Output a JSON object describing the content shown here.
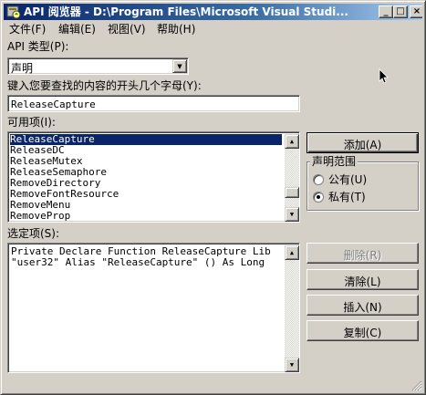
{
  "window": {
    "title": "API 阅览器 - D:\\Program Files\\Microsoft Visual Studi...",
    "minimize": "_",
    "maximize": "□",
    "close": "×"
  },
  "menu": {
    "file": "文件(F)",
    "edit": "编辑(E)",
    "view": "视图(V)",
    "help": "帮助(H)"
  },
  "api_type": {
    "label": "API 类型(P):",
    "value": "声明"
  },
  "search": {
    "label": "键入您要查找的内容的开头几个字母(Y):",
    "value": "ReleaseCapture"
  },
  "available": {
    "label": "可用项(I):",
    "items": [
      "ReleaseCapture",
      "ReleaseDC",
      "ReleaseMutex",
      "ReleaseSemaphore",
      "RemoveDirectory",
      "RemoveFontResource",
      "RemoveMenu",
      "RemoveProp"
    ],
    "selected_index": 0
  },
  "buttons": {
    "add": "添加(A)",
    "delete": "删除(R)",
    "clear": "清除(L)",
    "insert": "插入(N)",
    "copy": "复制(C)"
  },
  "scope": {
    "title": "声明范围",
    "public": "公有(U)",
    "private": "私有(T)",
    "selected": "private"
  },
  "selected": {
    "label": "选定项(S):",
    "line1": "Private Declare Function ReleaseCapture Lib",
    "line2": "\"user32\" Alias \"ReleaseCapture\" () As Long"
  },
  "colors": {
    "title_bar": "#0a246a",
    "selection": "#0a246a",
    "face": "#d4d0c8"
  }
}
